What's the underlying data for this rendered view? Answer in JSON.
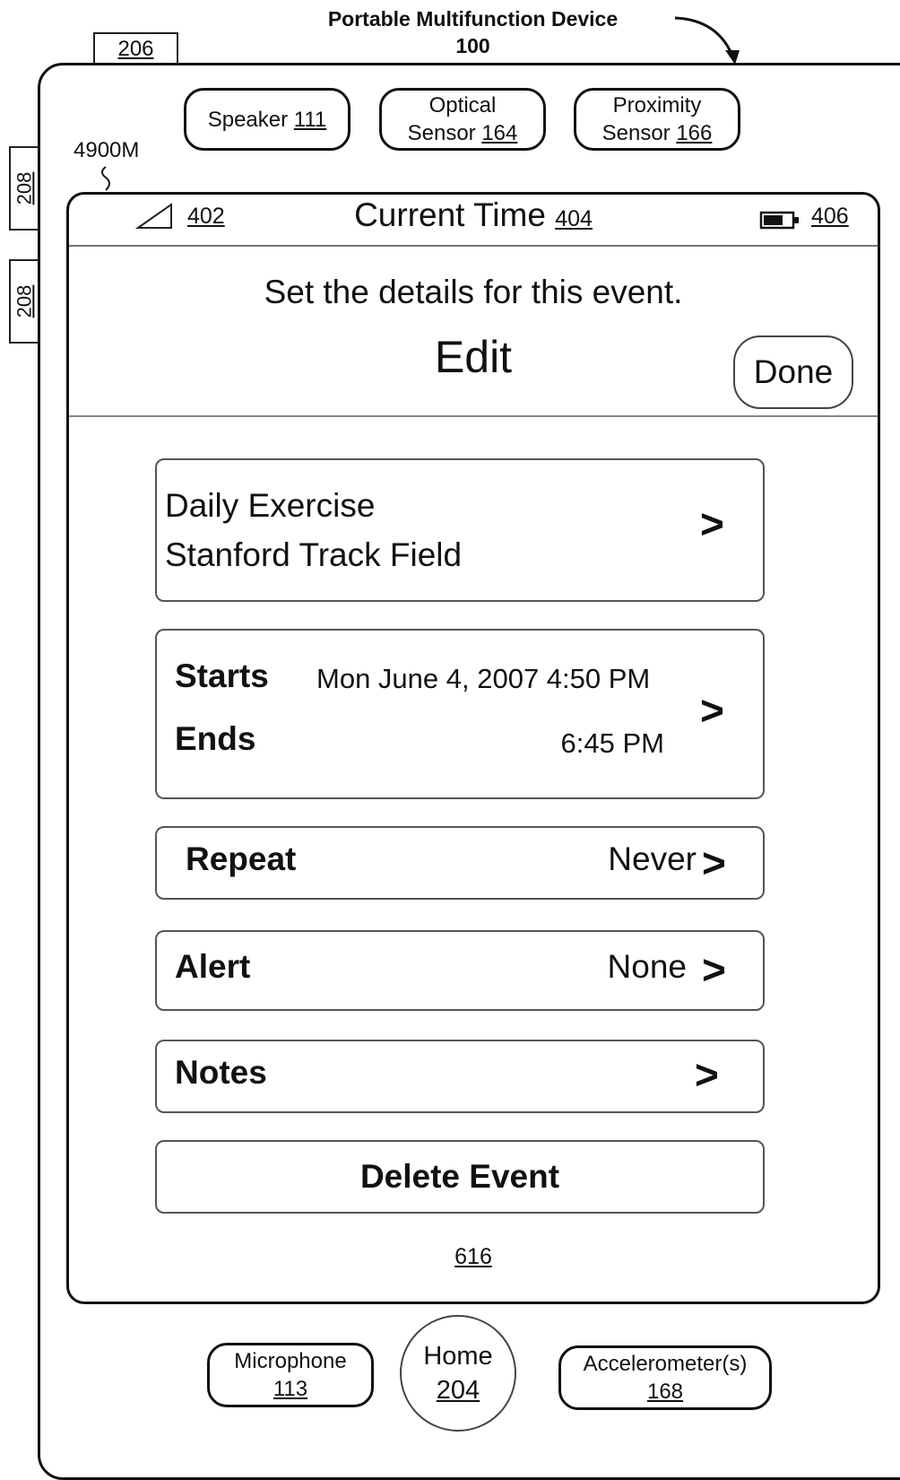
{
  "figure": {
    "title": "Portable Multifunction Device",
    "device_ref": "100",
    "screen_ref": "4900M",
    "screen_bottom_ref": "616",
    "side_tab_top": "206",
    "side_tabs": [
      "208",
      "208"
    ]
  },
  "sensors_top": [
    {
      "label": "Speaker",
      "ref": "111"
    },
    {
      "line1": "Optical",
      "line2": "Sensor",
      "ref": "164"
    },
    {
      "line1": "Proximity",
      "line2": "Sensor",
      "ref": "166"
    }
  ],
  "status_bar": {
    "signal_ref": "402",
    "title": "Current Time",
    "time_ref": "404",
    "battery_ref": "406"
  },
  "header": {
    "prompt": "Set the details for this event.",
    "title": "Edit",
    "done_label": "Done"
  },
  "event": {
    "name": "Daily Exercise",
    "location": "Stanford Track Field"
  },
  "times": {
    "starts_label": "Starts",
    "starts_value": "Mon June 4, 2007 4:50 PM",
    "ends_label": "Ends",
    "ends_value": "6:45 PM"
  },
  "repeat": {
    "label": "Repeat",
    "value": "Never"
  },
  "alert": {
    "label": "Alert",
    "value": "None"
  },
  "notes": {
    "label": "Notes"
  },
  "delete": {
    "label": "Delete Event"
  },
  "chevron": ">",
  "hardware_bottom": {
    "microphone": {
      "label": "Microphone",
      "ref": "113"
    },
    "home": {
      "label": "Home",
      "ref": "204"
    },
    "accelerometer": {
      "label": "Accelerometer(s)",
      "ref": "168"
    }
  }
}
